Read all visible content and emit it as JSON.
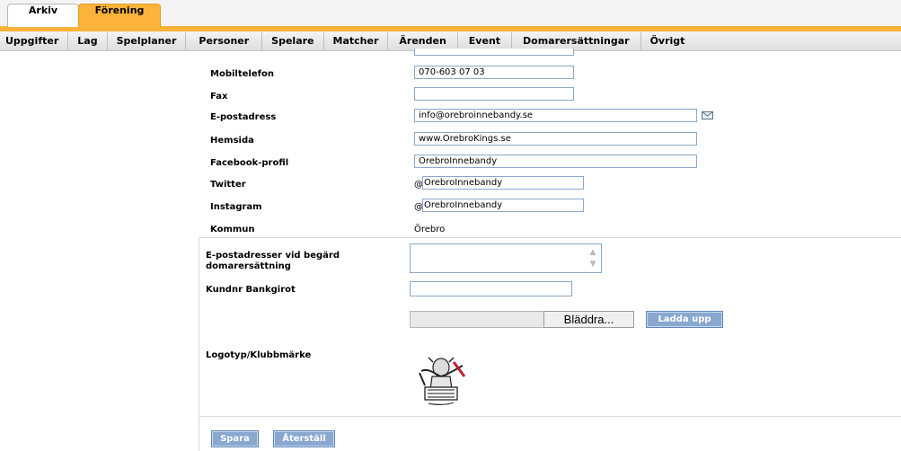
{
  "top_tabs": [
    {
      "label": "Arkiv"
    },
    {
      "label": "Förening"
    }
  ],
  "nav": [
    {
      "label": "Uppgifter"
    },
    {
      "label": "Lag"
    },
    {
      "label": "Spelplaner"
    },
    {
      "label": "Personer"
    },
    {
      "label": "Spelare"
    },
    {
      "label": "Matcher"
    },
    {
      "label": "Ärenden"
    },
    {
      "label": "Event"
    },
    {
      "label": "Domarersättningar"
    },
    {
      "label": "Övrigt"
    }
  ],
  "form": {
    "mobiltelefon": {
      "label": "Mobiltelefon",
      "value": "070-603 07 03"
    },
    "fax": {
      "label": "Fax",
      "value": ""
    },
    "epost": {
      "label": "E-postadress",
      "value": "info@orebroinnebandy.se"
    },
    "hemsida": {
      "label": "Hemsida",
      "value": "www.OrebroKings.se"
    },
    "facebook": {
      "label": "Facebook-profil",
      "value": "OrebroInnebandy"
    },
    "twitter": {
      "label": "Twitter",
      "prefix": "@",
      "value": "OrebroInnebandy"
    },
    "instagram": {
      "label": "Instagram",
      "prefix": "@",
      "value": "OrebroInnebandy"
    },
    "kommun": {
      "label": "Kommun",
      "value": "Örebro"
    },
    "domar_epost": {
      "label_line1": "E-postadresser vid begärd",
      "label_line2": "domarersättning",
      "value": ""
    },
    "bankgiro": {
      "label": "Kundnr Bankgirot",
      "value": ""
    },
    "browse_label": "Bläddra...",
    "upload_label": "Ladda upp",
    "logo_label": "Logotyp/Klubbmärke"
  },
  "actions": {
    "save_label": "Spara",
    "reset_label": "Återställ"
  },
  "icons": {
    "mail": "envelope-icon",
    "logo": "club-logo-image"
  },
  "colors": {
    "accent_tab": "#fbb33a",
    "button": "#88a8d0",
    "input_border": "#8aa8c8"
  }
}
